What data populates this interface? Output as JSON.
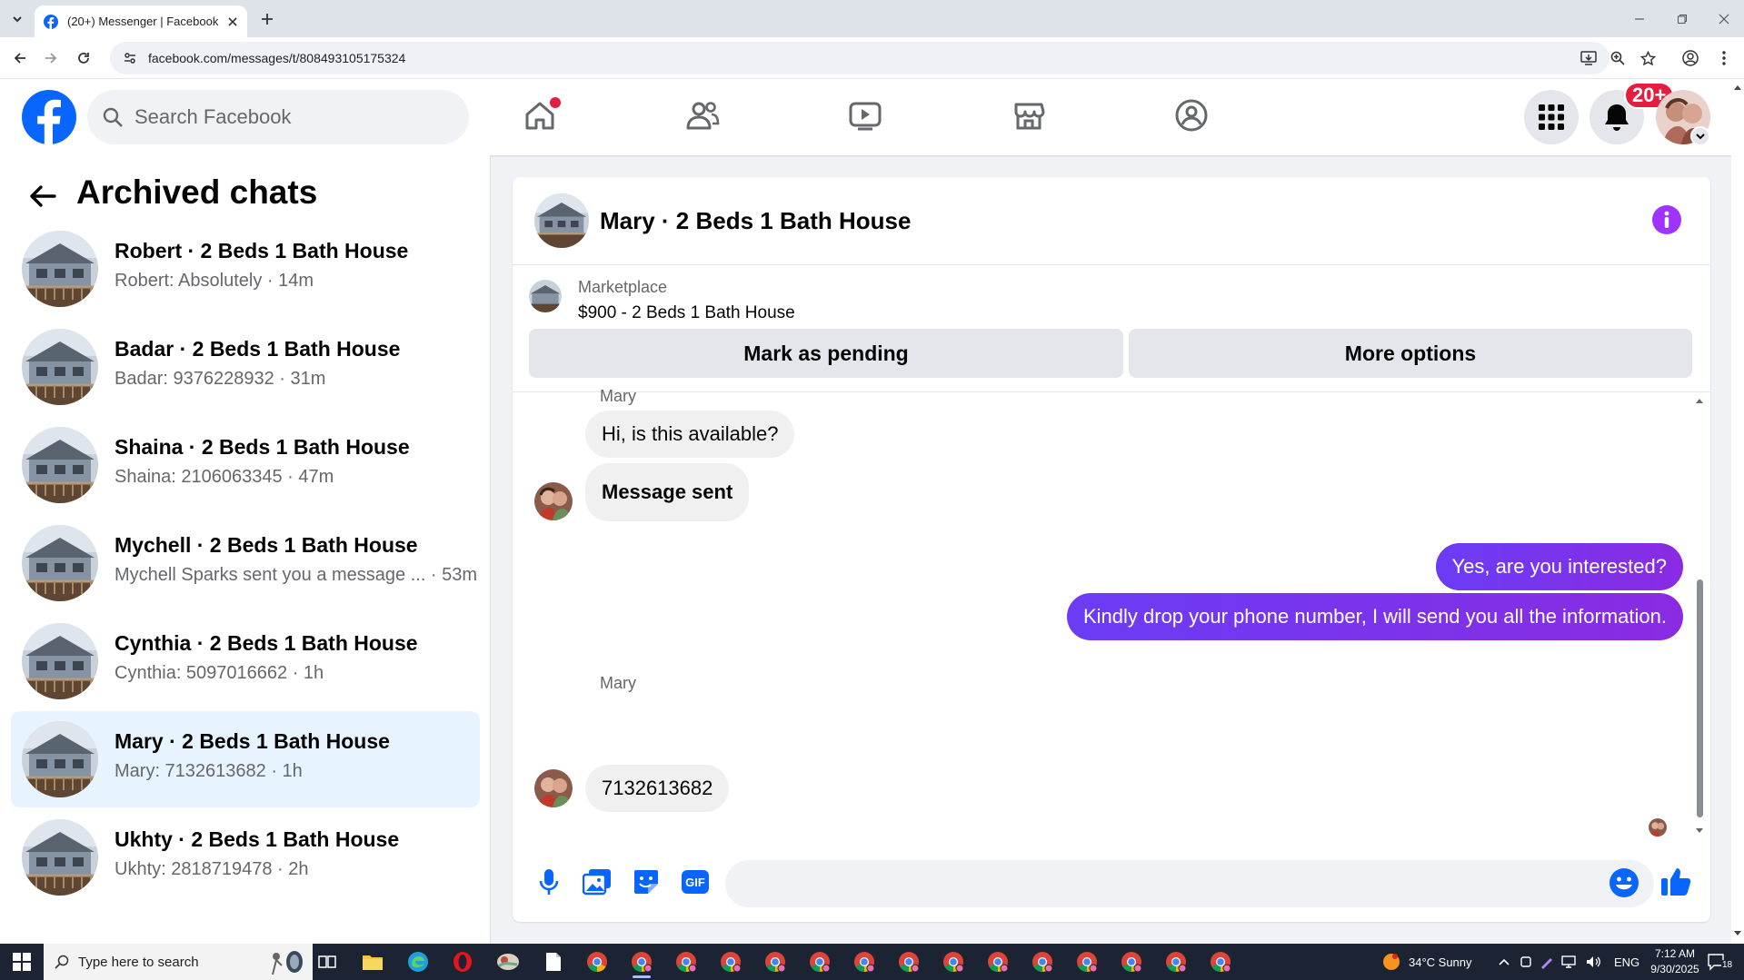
{
  "browser": {
    "tab_title": "(20+) Messenger | Facebook",
    "url": "facebook.com/messages/t/808493105175324"
  },
  "topbar": {
    "search_placeholder": "Search Facebook",
    "notification_badge": "20+",
    "brand_color": "#0866ff"
  },
  "left_panel": {
    "title": "Archived chats",
    "chats": [
      {
        "name": "Robert · 2 Beds 1 Bath House",
        "preview": "Robert: Absolutely · 14m",
        "active": false
      },
      {
        "name": "Badar · 2 Beds 1 Bath House",
        "preview": "Badar: 9376228932 · 31m",
        "active": false
      },
      {
        "name": "Shaina · 2 Beds 1 Bath House",
        "preview": "Shaina: 2106063345 · 47m",
        "active": false
      },
      {
        "name": "Mychell · 2 Beds 1 Bath House",
        "preview": "Mychell Sparks sent you a message ... · 53m",
        "active": false
      },
      {
        "name": "Cynthia · 2 Beds 1 Bath House",
        "preview": "Cynthia: 5097016662 · 1h",
        "active": false
      },
      {
        "name": "Mary · 2 Beds 1 Bath House",
        "preview": "Mary: 7132613682 · 1h",
        "active": true
      },
      {
        "name": "Ukhty · 2 Beds 1 Bath House",
        "preview": "Ukhty: 2818719478 · 2h",
        "active": false
      }
    ]
  },
  "conversation": {
    "title": "Mary · 2 Beds 1 Bath House",
    "marketplace_label": "Marketplace",
    "listing": "$900 - 2 Beds 1 Bath House",
    "mark_pending_label": "Mark as pending",
    "more_options_label": "More options",
    "messages": [
      {
        "from": "Mary",
        "sender_label": "Mary",
        "text": "Hi, is this available?"
      },
      {
        "from": "Mary",
        "text": "Message sent"
      },
      {
        "from": "me",
        "text": "Yes, are you interested?"
      },
      {
        "from": "me",
        "text": "Kindly drop your phone number, I will send you all the information."
      },
      {
        "from": "Mary",
        "sender_label": "Mary",
        "text": "7132613682"
      }
    ],
    "outgoing_color": "#7b2ff2",
    "accent_color": "#a033ff"
  },
  "taskbar": {
    "search_placeholder": "Type here to search",
    "weather": "34°C  Sunny",
    "language": "ENG",
    "time": "7:12 AM",
    "date": "9/30/2025",
    "notification_count": "18"
  }
}
